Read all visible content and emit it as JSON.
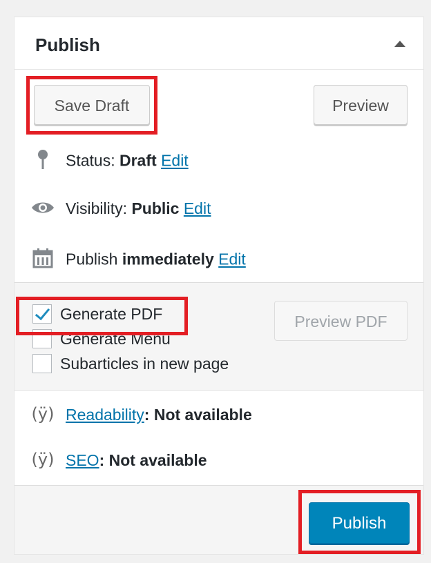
{
  "box": {
    "title": "Publish"
  },
  "actions": {
    "save_draft_label": "Save Draft",
    "preview_label": "Preview"
  },
  "status": {
    "prefix": "Status:",
    "value": "Draft",
    "edit": "Edit"
  },
  "visibility": {
    "prefix": "Visibility:",
    "value": "Public",
    "edit": "Edit"
  },
  "schedule": {
    "prefix": "Publish",
    "value": "immediately",
    "edit": "Edit"
  },
  "pdf_options": {
    "checkboxes": [
      {
        "label": "Generate PDF",
        "checked": true
      },
      {
        "label": "Generate Menu",
        "checked": false
      },
      {
        "label": "Subarticles in new page",
        "checked": false
      }
    ],
    "preview_pdf_label": "Preview PDF"
  },
  "seo": {
    "readability_link": "Readability",
    "readability_value": ": Not available",
    "seo_link": "SEO",
    "seo_value": ": Not available"
  },
  "footer": {
    "publish_label": "Publish"
  },
  "icons": {
    "status": "pin-icon",
    "visibility": "eye-icon",
    "schedule": "calendar-icon",
    "yoast": "yoast-icon",
    "collapse": "triangle-up-icon"
  },
  "colors": {
    "accent": "#0085ba",
    "link": "#0073aa",
    "highlight": "#e31e24"
  }
}
